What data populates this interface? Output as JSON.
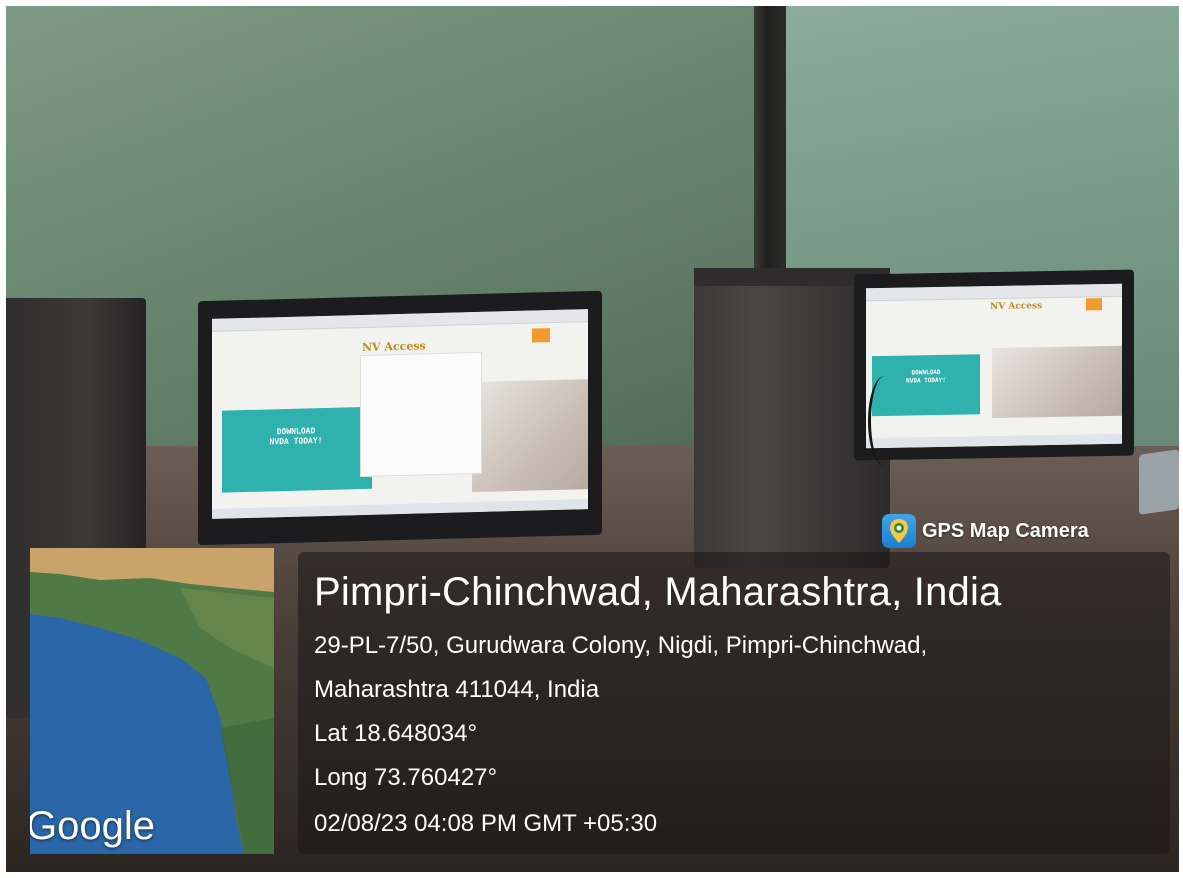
{
  "badge": {
    "label": "GPS Map Camera",
    "icon": "gps-map-camera-icon"
  },
  "location": {
    "title": "Pimpri-Chinchwad, Maharashtra, India",
    "address_line1": "29-PL-7/50, Gurudwara Colony, Nigdi, Pimpri-Chinchwad,",
    "address_line2": "Maharashtra 411044, India",
    "lat": "Lat 18.648034°",
    "long": "Long 73.760427°",
    "datetime": "02/08/23 04:08 PM GMT +05:30"
  },
  "map": {
    "provider": "Google",
    "colors": {
      "water": "#2b66a8",
      "land": "#4f7a45",
      "desert": "#c8a46a"
    }
  },
  "screens": {
    "left": {
      "site_name": "NV Access",
      "banner_line1": "DOWNLOAD",
      "banner_line2": "NVDA TODAY!"
    },
    "right": {
      "site_name": "NV Access",
      "banner_line1": "DOWNLOAD",
      "banner_line2": "NVDA TODAY!"
    }
  },
  "colors": {
    "overlay": "#1c1616",
    "teal_banner": "#2fb1ad",
    "wall": "#6d8a72",
    "gps_icon": "#1f7ed0"
  }
}
